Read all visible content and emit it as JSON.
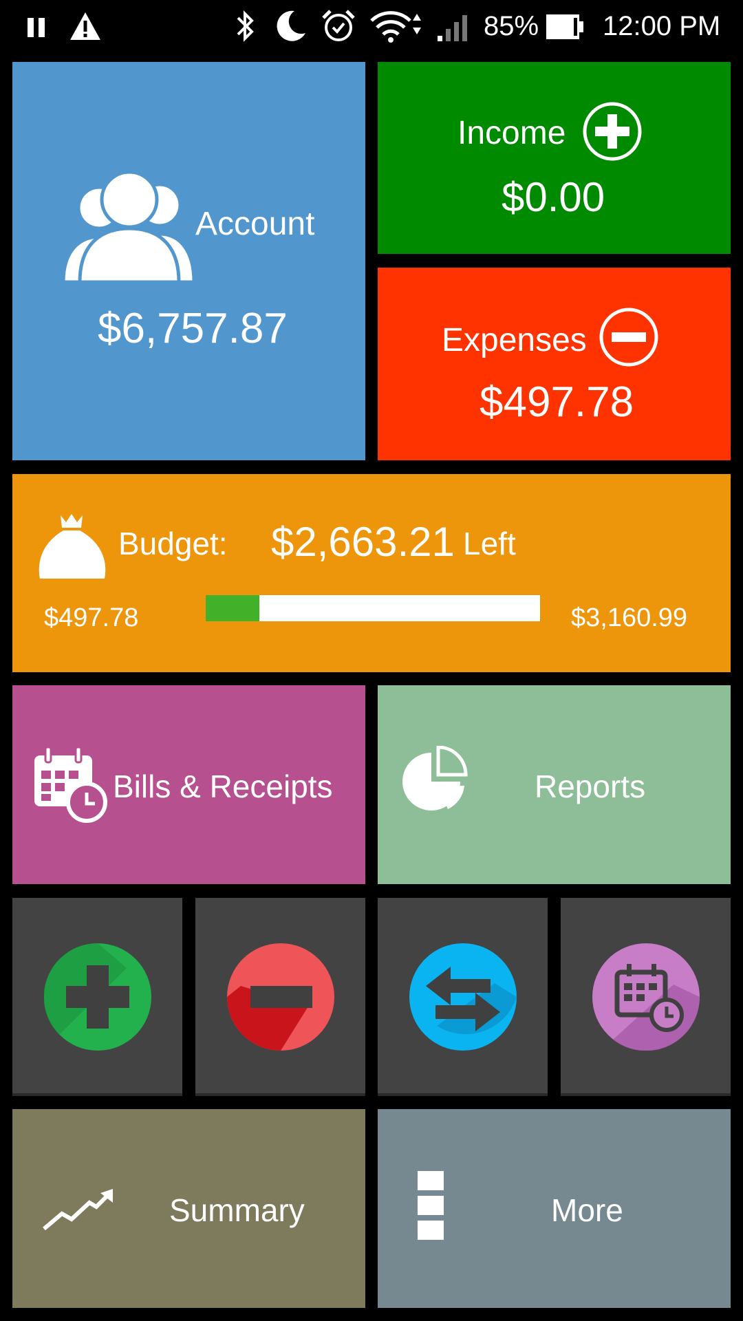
{
  "status_bar": {
    "battery": "85%",
    "time": "12:00 PM",
    "icons": [
      "pause-icon",
      "warning-icon",
      "bluetooth-icon",
      "moon-icon",
      "alarm-icon",
      "wifi-icon",
      "signal-icon",
      "battery-icon"
    ]
  },
  "account": {
    "label": "Account",
    "amount": "$6,757.87",
    "icon": "people-icon"
  },
  "income": {
    "label": "Income",
    "amount": "$0.00",
    "icon": "plus-circle-icon"
  },
  "expenses": {
    "label": "Expenses",
    "amount": "$497.78",
    "icon": "minus-circle-icon"
  },
  "budget": {
    "label": "Budget:",
    "left_amount": "$2,663.21",
    "left_label": "Left",
    "spent": "$497.78",
    "total": "$3,160.99",
    "progress_fraction": 0.16,
    "icon": "money-bag-icon"
  },
  "bills": {
    "label": "Bills & Receipts",
    "icon": "calendar-clock-icon"
  },
  "reports": {
    "label": "Reports",
    "icon": "pie-chart-icon"
  },
  "quick_actions": [
    {
      "name": "add-income-icon",
      "color": "#22b14c"
    },
    {
      "name": "add-expense-icon",
      "color": "#ef5459"
    },
    {
      "name": "transfer-icon",
      "color": "#0ab4f0"
    },
    {
      "name": "schedule-bill-icon",
      "color": "#c77ec7"
    }
  ],
  "summary": {
    "label": "Summary",
    "icon": "trend-up-icon"
  },
  "more": {
    "label": "More",
    "icon": "menu-blocks-icon"
  },
  "colors": {
    "account": "#5196cd",
    "income": "#008a00",
    "expenses": "#ff3300",
    "budget": "#ed960c",
    "bills": "#b7508f",
    "reports": "#8ebe98",
    "summary": "#7e7a5c",
    "more": "#768990",
    "progress_fill": "#43b02a"
  }
}
